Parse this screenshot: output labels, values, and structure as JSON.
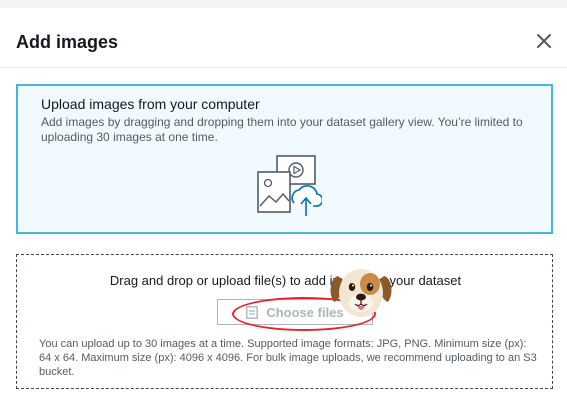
{
  "modal": {
    "title": "Add images",
    "close_icon": "close-icon"
  },
  "info_panel": {
    "title": "Upload images from your computer",
    "description": "Add images by dragging and dropping them into your dataset gallery view. You’re limited to uploading 30 images at one time.",
    "illustration_icon": "image-upload-illustration-icon"
  },
  "drop_zone": {
    "text": "Drag and drop or upload file(s) to add images to your dataset",
    "button_label": "Choose files",
    "button_icon": "file-icon",
    "helper_text": "You can upload up to 30 images at a time. Supported image formats: JPG, PNG. Minimum size (px): 64 x 64. Maximum size (px): 4096 x 4096. For bulk image uploads, we recommend uploading to an S3 bucket."
  },
  "annotation": {
    "highlight_color": "#e8242e",
    "mascot_icon": "dog-face-icon"
  },
  "colors": {
    "info_border": "#44b9d6",
    "info_background": "#f1faff",
    "upload_arrow": "#0073bb"
  }
}
